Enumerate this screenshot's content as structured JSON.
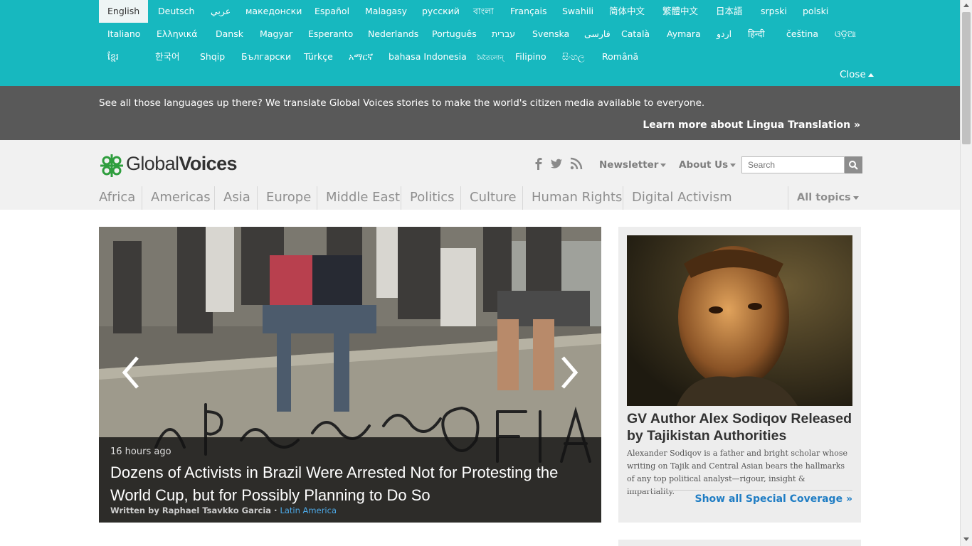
{
  "languages": {
    "row1": [
      "English",
      "Deutsch",
      "عربي",
      "македонски",
      "Español",
      "Malagasy",
      "русский",
      "বাংলা",
      "Français",
      "Swahili",
      "简体中文",
      "繁體中文",
      "日本語",
      "srpski",
      "polski"
    ],
    "row2": [
      "Italiano",
      "Ελληνικά",
      "Dansk",
      "Magyar",
      "Esperanto",
      "Nederlands",
      "Português",
      "עברית",
      "Svenska",
      "فارسی",
      "Català",
      "Aymara",
      "اردو",
      "हिन्दी",
      "čeština",
      "ଓଡ଼ିଆ"
    ],
    "row3": [
      "ខ្មែរ",
      "한국어",
      "Shqip",
      "Български",
      "Türkçe",
      "አማርኛ",
      "bahasa Indonesia",
      "মৈতৈলোন্",
      "Filipino",
      "සිංහල",
      "Română"
    ],
    "active": "English",
    "close_label": "Close"
  },
  "promo": {
    "text": "See all those languages up there? We translate Global Voices stories to make the world's citizen media available to everyone.",
    "link": "Learn more about Lingua Translation »"
  },
  "header": {
    "logo_global": "Global",
    "logo_voices": "Voices",
    "newsletter": "Newsletter",
    "about": "About Us",
    "search_placeholder": "Search",
    "topics": [
      "Africa",
      "Americas",
      "Asia",
      "Europe",
      "Middle East",
      "Politics",
      "Culture",
      "Human Rights",
      "Digital Activism"
    ],
    "all_topics": "All topics"
  },
  "feature": {
    "time": "16 hours ago",
    "title": "Dozens of Activists in Brazil Were Arrested Not for Protesting the World Cup, but for Possibly Planning to Do So",
    "written_by": "Written by Raphael Tsavkko Garcia",
    "separator": " · ",
    "region": "Latin America"
  },
  "sidebar": {
    "title": "GV Author Alex Sodiqov Released by Tajikistan Authorities",
    "desc": "Alexander Sodiqov is a father and bright scholar whose writing on Tajik and Central Asian bears the hallmarks of any top political analyst—rigour, insight & impartiality.",
    "link": "Show all Special Coverage »"
  },
  "colors": {
    "langbar": "#17b8bf",
    "promo": "#595959",
    "link": "#1f7dc4",
    "logo_green": "#2f9e3e"
  }
}
